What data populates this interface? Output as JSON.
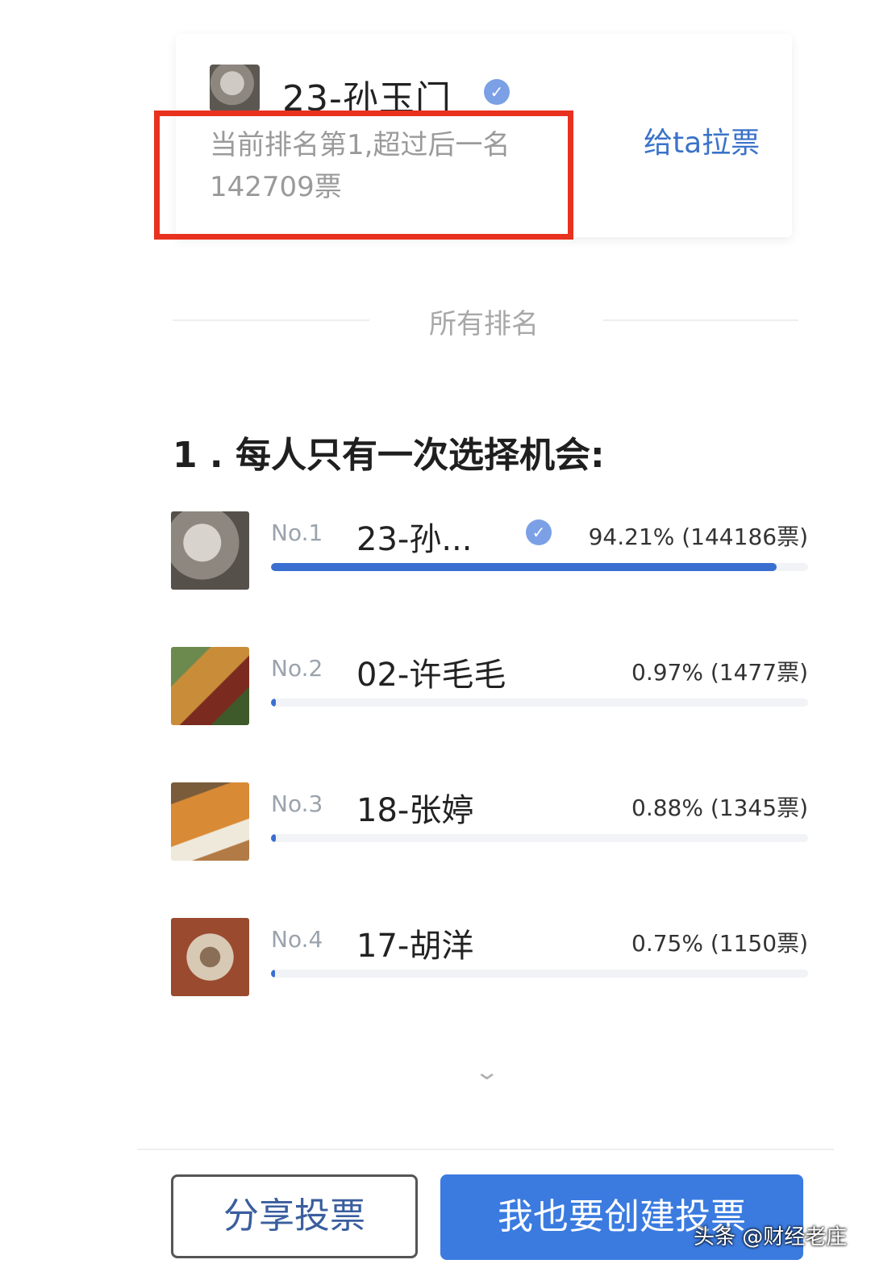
{
  "top_card": {
    "name": "23-孙玉门",
    "rank_info": "当前排名第1,超过后一名142709票",
    "canvass_label": "给ta拉票"
  },
  "verify_glyph": "✓",
  "divider_label": "所有排名",
  "question": "1 . 每人只有一次选择机会:",
  "rankings": [
    {
      "no": "No.1",
      "name": "23-孙...",
      "verified": true,
      "stat": "94.21% (144186票)",
      "percent": 94.21,
      "votes": 144186,
      "thumb": "gray-photo"
    },
    {
      "no": "No.2",
      "name": "02-许毛毛",
      "verified": false,
      "stat": "0.97% (1477票)",
      "percent": 0.97,
      "votes": 1477,
      "thumb": "food-photo"
    },
    {
      "no": "No.3",
      "name": "18-张婷",
      "verified": false,
      "stat": "0.88% (1345票)",
      "percent": 0.88,
      "votes": 1345,
      "thumb": "food-photo"
    },
    {
      "no": "No.4",
      "name": "17-胡洋",
      "verified": false,
      "stat": "0.75% (1150票)",
      "percent": 0.75,
      "votes": 1150,
      "thumb": "food-photo"
    }
  ],
  "expand_icon": "chevron-down-icon",
  "buttons": {
    "share": "分享投票",
    "create": "我也要创建投票"
  },
  "watermark": "头条 @财经老庄",
  "colors": {
    "accent": "#3a6fd0",
    "highlight_border": "#e8321f",
    "link": "#3a72c9"
  }
}
